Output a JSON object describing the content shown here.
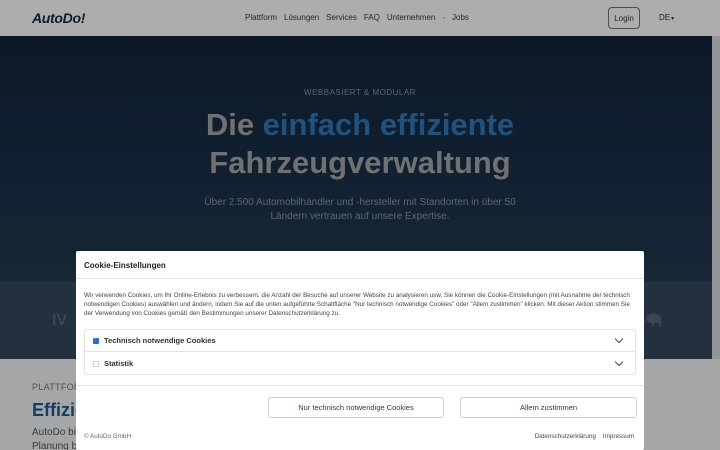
{
  "header": {
    "logo": "AutoDo!",
    "nav": [
      "Plattform",
      "Lösungen",
      "Services",
      "FAQ",
      "Unternehmen",
      "-",
      "Jobs"
    ],
    "login": "Login",
    "language": "DE"
  },
  "hero": {
    "eyebrow": "WEBBASIERT & MODULAR",
    "headline_pre": "Die ",
    "headline_accent": "einfach effiziente",
    "headline_line2": "Fahrzeugverwaltung",
    "subtext": "Über 2.500 Automobilhändler und -hersteller mit Standorten in über 50 Ländern vertrauen auf unsere Expertise."
  },
  "strip": {
    "left_logo": "IV"
  },
  "content": {
    "kicker": "PLATTFORM",
    "title": "Effizie",
    "text_line1": "AutoDo bi",
    "text_line2": "Planung b"
  },
  "cookie_modal": {
    "title": "Cookie-Einstellungen",
    "body": "Wir verwenden Cookies, um Ihr Online-Erlebnis zu verbessern, die Anzahl der Besuche auf unserer Website zu analysieren usw. Sie können die Cookie-Einstellungen (mit Ausnahme der technisch notwendigen Cookies) auswählen und ändern, indem Sie auf die unten aufgeführte Schaltfläche \"Nur technisch notwendige Cookies\" oder \"Allem zustimmen\" klicken. Mit dieser Aktion stimmen Sie der Verwendung von Cookies gemäß den Bestimmungen unserer Datenschutzerklärung zu.",
    "categories": [
      {
        "label": "Technisch notwendige Cookies",
        "checked": true
      },
      {
        "label": "Statistik",
        "checked": false
      }
    ],
    "btn_necessary": "Nur technisch notwendige Cookies",
    "btn_accept_all": "Allem zustimmen",
    "copyright": "© AutoDo GmbH",
    "link_privacy": "Datenschutzerklärung",
    "link_imprint": "Impressum"
  },
  "colors": {
    "accent": "#2d7bbf",
    "hero_bg": "#1a3149",
    "checkbox": "#1f74c9"
  }
}
